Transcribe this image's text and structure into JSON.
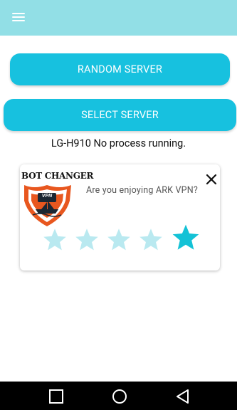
{
  "toolbar": {
    "menu_icon": "hamburger-menu-icon"
  },
  "buttons": {
    "random_server": "RANDOM SERVER",
    "select_server": "SELECT SERVER"
  },
  "status_text": "LG-H910 No process running.",
  "rating_card": {
    "logo_text": "BOT CHANGER",
    "logo_badge": "VPN",
    "question": "Are you enjoying ARK VPN?",
    "rating": 5,
    "max_rating": 5
  },
  "colors": {
    "toolbar": "#92dfe6",
    "button": "#17c1df",
    "star_inactive": "#b9e9f0",
    "star_active": "#14c2d6",
    "logo_orange": "#e8571f"
  },
  "navbar": {
    "icons": [
      "recents-square-icon",
      "home-circle-icon",
      "back-triangle-icon"
    ]
  }
}
